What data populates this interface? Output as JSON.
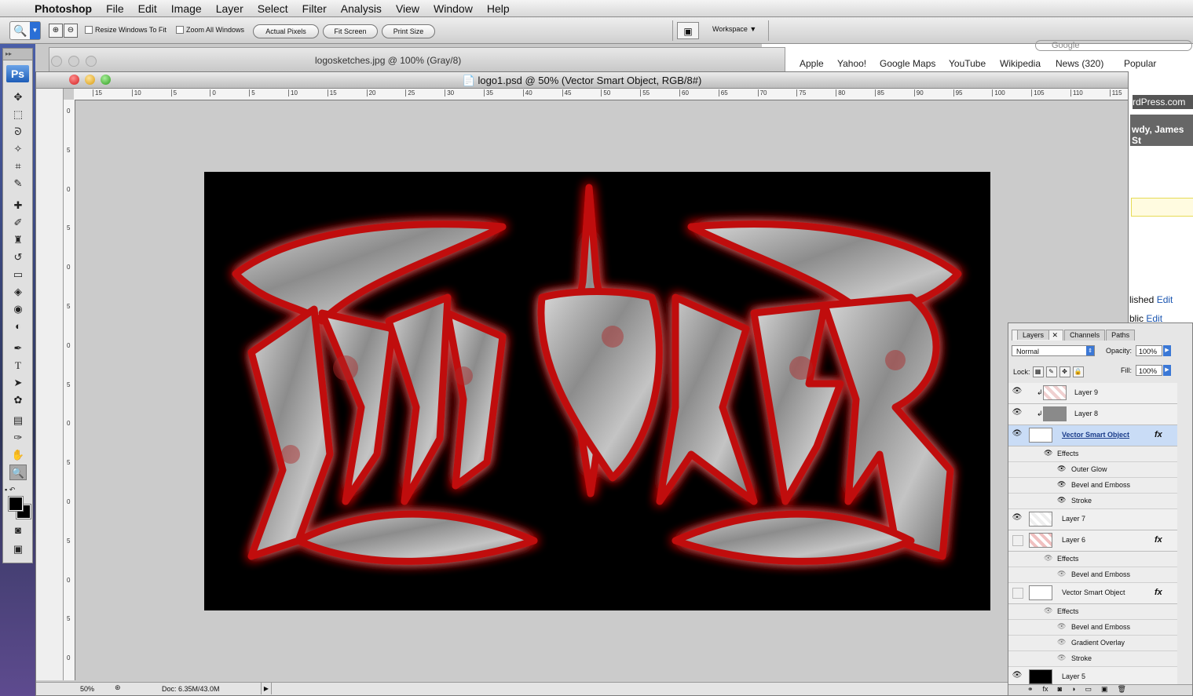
{
  "menubar": {
    "app": "Photoshop",
    "items": [
      "File",
      "Edit",
      "Image",
      "Layer",
      "Select",
      "Filter",
      "Analysis",
      "View",
      "Window",
      "Help"
    ]
  },
  "options": {
    "resize_label": "Resize Windows To Fit",
    "zoom_all_label": "Zoom All Windows",
    "actual_pixels": "Actual Pixels",
    "fit_screen": "Fit Screen",
    "print_size": "Print Size",
    "workspace": "Workspace"
  },
  "browser": {
    "search_placeholder": "Google",
    "bookmarks": [
      "Apple",
      "Yahoo!",
      "Google Maps",
      "YouTube",
      "Wikipedia",
      "News (320)",
      "Popular"
    ],
    "wp_domain": "rdPress.com",
    "howdy": "wdy, James St",
    "published": "lished",
    "public": "blic",
    "edit": "Edit"
  },
  "back_doc": {
    "title": "logosketches.jpg @ 100% (Gray/8)"
  },
  "toolbox": {
    "badge": "Ps"
  },
  "document": {
    "title": "logo1.psd @ 50% (Vector Smart Object, RGB/8#)",
    "ruler_h": [
      "15",
      "10",
      "5",
      "0",
      "5",
      "10",
      "15",
      "20",
      "25",
      "30",
      "35",
      "40",
      "45",
      "50",
      "55",
      "60",
      "65",
      "70",
      "75",
      "80",
      "85",
      "90",
      "95",
      "100",
      "105",
      "110",
      "115"
    ],
    "ruler_v": [
      "0",
      "5",
      "0",
      "5",
      "0",
      "5",
      "0",
      "5",
      "0",
      "5",
      "0",
      "5",
      "0",
      "5",
      "0"
    ],
    "zoom": "50%",
    "doc_size": "Doc: 6.35M/43.0M"
  },
  "layers_panel": {
    "tabs": [
      "Layers",
      "Channels",
      "Paths"
    ],
    "blend_mode": "Normal",
    "opacity_label": "Opacity:",
    "opacity": "100%",
    "lock_label": "Lock:",
    "fill_label": "Fill:",
    "fill": "100%",
    "layers": [
      {
        "name": "Layer 9"
      },
      {
        "name": "Layer 8"
      },
      {
        "name": "Vector Smart Object"
      },
      {
        "name": "Effects"
      },
      {
        "name": "Outer Glow"
      },
      {
        "name": "Bevel and Emboss"
      },
      {
        "name": "Stroke"
      },
      {
        "name": "Layer 7"
      },
      {
        "name": "Layer 6"
      },
      {
        "name": "Effects"
      },
      {
        "name": "Bevel and Emboss"
      },
      {
        "name": "Vector Smart Object"
      },
      {
        "name": "Effects"
      },
      {
        "name": "Bevel and Emboss"
      },
      {
        "name": "Gradient Overlay"
      },
      {
        "name": "Stroke"
      },
      {
        "name": "Layer 5"
      }
    ],
    "fx": "fx"
  },
  "colors": {
    "accent": "#2a6fd6",
    "glow": "#d01010",
    "canvas": "#000000"
  }
}
